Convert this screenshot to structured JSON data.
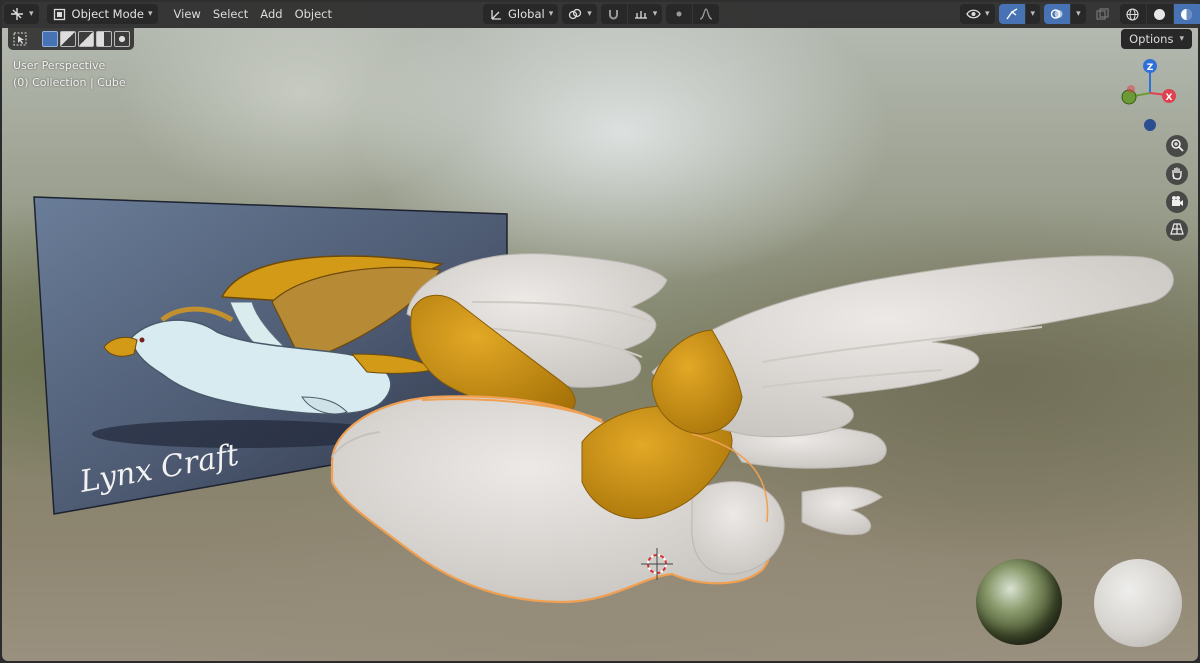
{
  "header": {
    "editor_type_icon": "view3d-editor-icon",
    "mode_label": "Object Mode",
    "menus": [
      "View",
      "Select",
      "Add",
      "Object"
    ],
    "transform_orientation": "Global",
    "options_label": "Options"
  },
  "viewport": {
    "view_name": "User Perspective",
    "collection_info": "(0) Collection | Cube"
  },
  "gizmo": {
    "z_label": "Z",
    "x_label": "X"
  },
  "reference_image": {
    "signature_text": "Lynx Craft"
  },
  "colors": {
    "accent": "#4772b3",
    "selection_outline": "#f0a050",
    "model_white": "#dedbd7",
    "model_gold": "#d39a18",
    "axis_x": "#e0404f",
    "axis_y": "#6b9b34",
    "axis_z": "#2e6fd9"
  }
}
